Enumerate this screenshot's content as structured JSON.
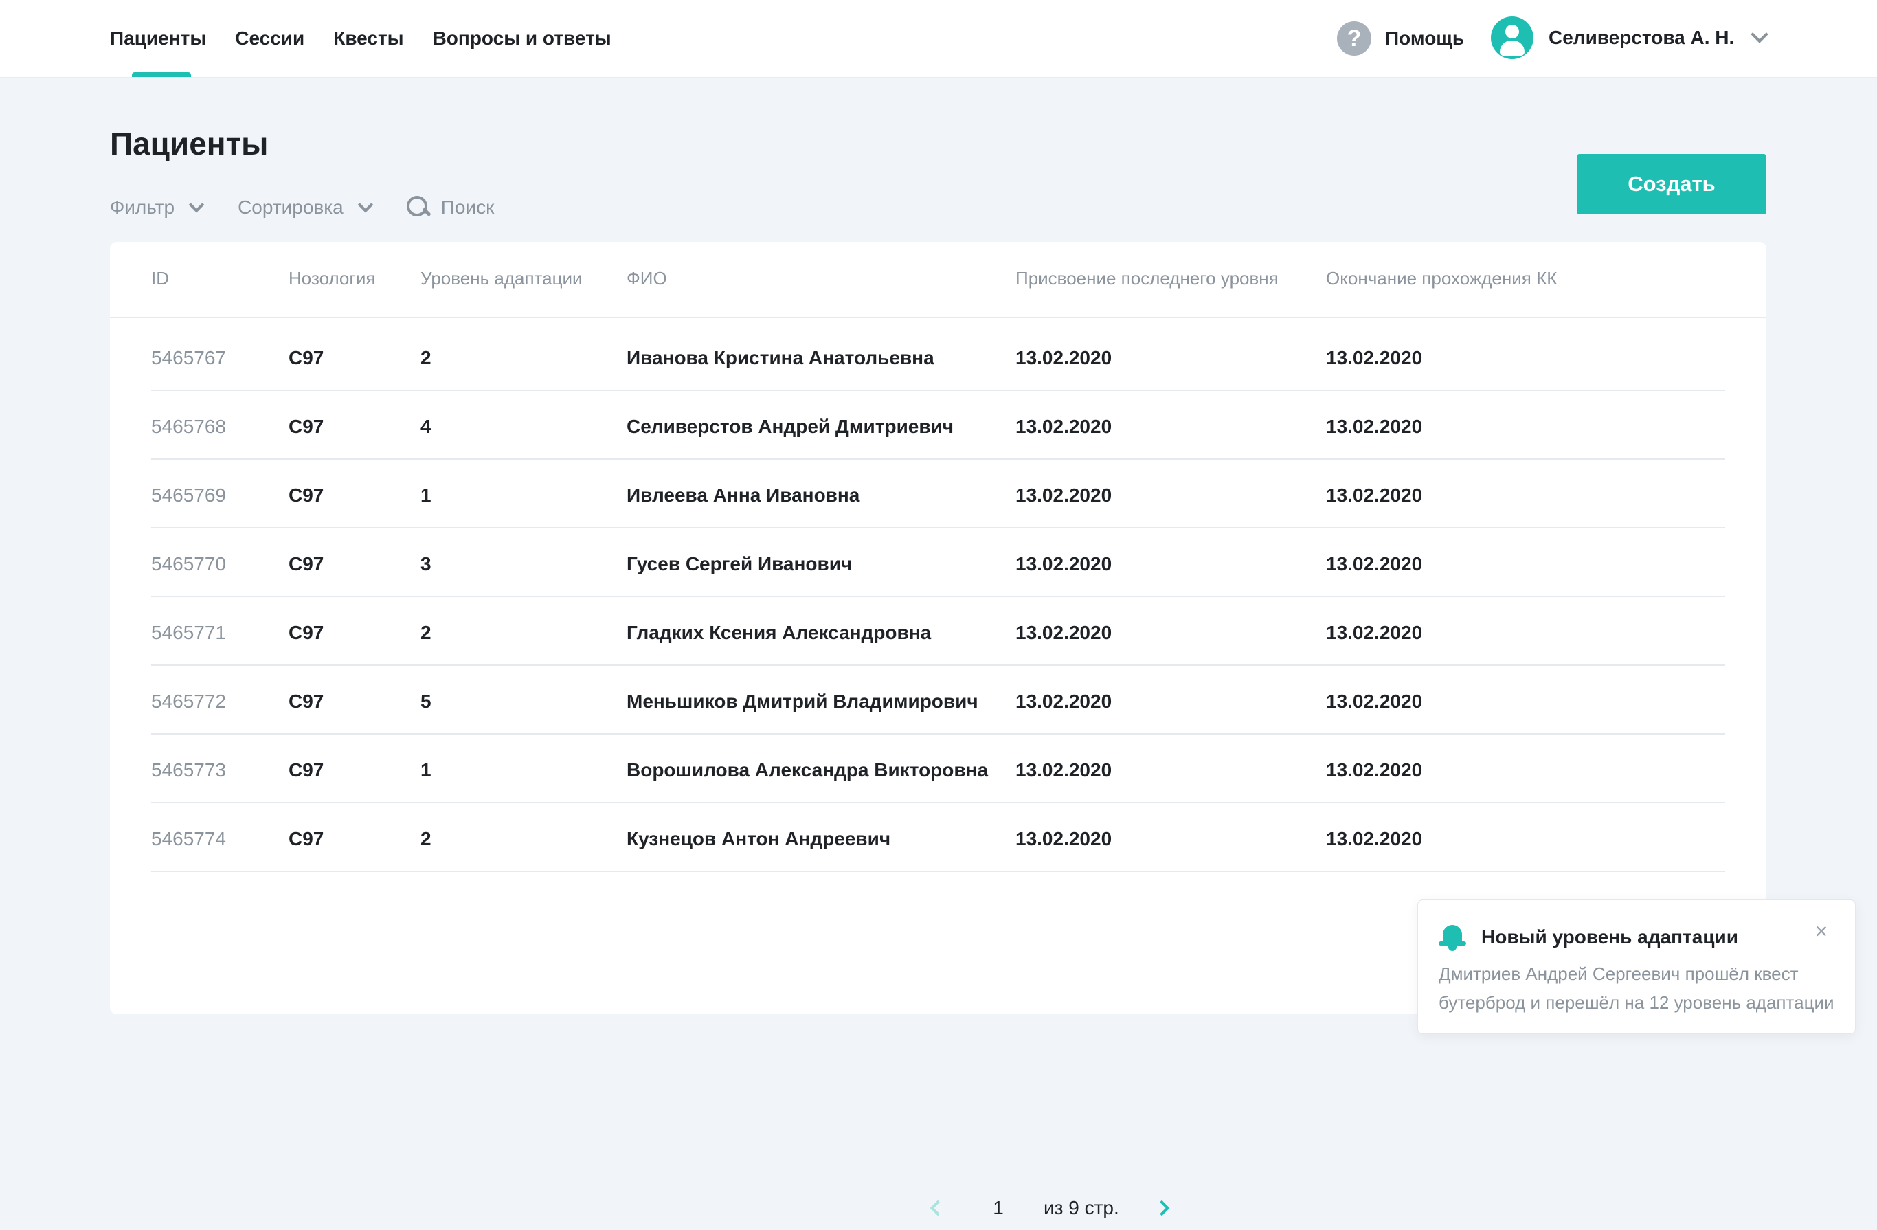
{
  "nav": {
    "items": [
      {
        "label": "Пациенты",
        "name": "nav-patients"
      },
      {
        "label": "Сессии",
        "name": "nav-sessions"
      },
      {
        "label": "Квесты",
        "name": "nav-quests"
      },
      {
        "label": "Вопросы и ответы",
        "name": "nav-faq"
      }
    ],
    "active_index": 0
  },
  "header": {
    "help_label": "Помощь",
    "help_icon": "help-icon",
    "user_name": "Селиверстова А. Н.",
    "user_icon": "avatar-icon"
  },
  "page": {
    "title": "Пациенты",
    "filter_label": "Фильтр",
    "sort_label": "Сортировка",
    "search_placeholder": "Поиск",
    "create_label": "Создать"
  },
  "colors": {
    "accent": "#1ebfb2",
    "background": "#f1f5f9",
    "muted_text": "#8b939c"
  },
  "table": {
    "columns": [
      "ID",
      "Нозология",
      "Уровень адаптации",
      "ФИО",
      "Присвоение последнего уровня",
      "Окончание прохождения КК"
    ],
    "rows": [
      [
        "5465767",
        "C97",
        "2",
        "Иванова Кристина Анатольевна",
        "13.02.2020",
        "13.02.2020"
      ],
      [
        "5465768",
        "C97",
        "4",
        "Селиверстов Андрей Дмитриевич",
        "13.02.2020",
        "13.02.2020"
      ],
      [
        "5465769",
        "C97",
        "1",
        "Ивлеева Анна Ивановна",
        "13.02.2020",
        "13.02.2020"
      ],
      [
        "5465770",
        "C97",
        "3",
        "Гусев Сергей Иванович",
        "13.02.2020",
        "13.02.2020"
      ],
      [
        "5465771",
        "C97",
        "2",
        "Гладких Ксения Александровна",
        "13.02.2020",
        "13.02.2020"
      ],
      [
        "5465772",
        "C97",
        "5",
        "Меньшиков Дмитрий Владимирович",
        "13.02.2020",
        "13.02.2020"
      ],
      [
        "5465773",
        "C97",
        "1",
        "Ворошилова Александра Викторовна",
        "13.02.2020",
        "13.02.2020"
      ],
      [
        "5465774",
        "C97",
        "2",
        "Кузнецов Антон Андреевич",
        "13.02.2020",
        "13.02.2020"
      ]
    ]
  },
  "pagination": {
    "current_page": "1",
    "total_label": "из 9 стр."
  },
  "toast": {
    "icon": "bell-icon",
    "title": "Новый уровень адаптации",
    "text": "Дмитриев Андрей Сергеевич прошёл квест бутерброд и перешёл на 12 уровень адаптации",
    "close_symbol": "×"
  }
}
